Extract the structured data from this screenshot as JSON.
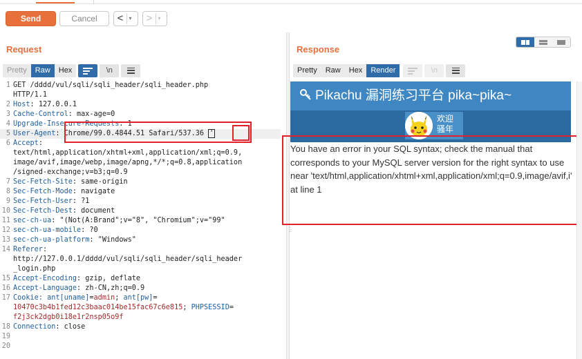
{
  "toolbar": {
    "send_label": "Send",
    "cancel_label": "Cancel",
    "back_glyph": "<",
    "forward_glyph": ">",
    "dropdown_glyph": "▾"
  },
  "request": {
    "title": "Request",
    "modes": [
      "Pretty",
      "Raw",
      "Hex"
    ],
    "selected_mode": "Raw",
    "newline_label": "\\n",
    "lines": [
      {
        "n": "1",
        "text": "GET /dddd/vul/sqli/sqli_header/sqli_header.php"
      },
      {
        "n": "",
        "text": "HTTP/1.1"
      },
      {
        "n": "2",
        "key": "Host",
        "value": "127.0.0.1"
      },
      {
        "n": "3",
        "key": "Cache-Control",
        "value": "max-age=0"
      },
      {
        "n": "4",
        "key": "Upgrade-Insecure-Requests",
        "value": "1"
      },
      {
        "n": "5",
        "key": "User-Agent",
        "value": "Chrome/99.0.4844.51 Safari/537.36",
        "caret": "'"
      },
      {
        "n": "6",
        "key": "Accept",
        "value": ""
      },
      {
        "n": "",
        "text": "text/html,application/xhtml+xml,application/xml;q=0.9,"
      },
      {
        "n": "",
        "text": "image/avif,image/webp,image/apng,*/*;q=0.8,application"
      },
      {
        "n": "",
        "text": "/signed-exchange;v=b3;q=0.9"
      },
      {
        "n": "7",
        "key": "Sec-Fetch-Site",
        "value": "same-origin"
      },
      {
        "n": "8",
        "key": "Sec-Fetch-Mode",
        "value": "navigate"
      },
      {
        "n": "9",
        "key": "Sec-Fetch-User",
        "value": "?1"
      },
      {
        "n": "10",
        "key": "Sec-Fetch-Dest",
        "value": "document"
      },
      {
        "n": "11",
        "key": "sec-ch-ua",
        "value": "\"(Not(A:Brand\";v=\"8\", \"Chromium\";v=\"99\""
      },
      {
        "n": "12",
        "key": "sec-ch-ua-mobile",
        "value": "?0"
      },
      {
        "n": "13",
        "key": "sec-ch-ua-platform",
        "value": "\"Windows\""
      },
      {
        "n": "14",
        "key": "Referer",
        "value": ""
      },
      {
        "n": "",
        "text": "http://127.0.0.1/dddd/vul/sqli/sqli_header/sqli_header"
      },
      {
        "n": "",
        "text": "_login.php"
      },
      {
        "n": "15",
        "key": "Accept-Encoding",
        "value": "gzip, deflate"
      },
      {
        "n": "16",
        "key": "Accept-Language",
        "value": "zh-CN,zh;q=0.9"
      },
      {
        "n": "17",
        "cookie": [
          {
            "t": "Cookie: ant[uname]",
            "c": "k"
          },
          {
            "t": "=",
            "c": ""
          },
          {
            "t": "admin",
            "c": "v"
          },
          {
            "t": "; ",
            "c": ""
          },
          {
            "t": "ant[pw]",
            "c": "k"
          },
          {
            "t": "=",
            "c": ""
          }
        ]
      },
      {
        "n": "",
        "cookie": [
          {
            "t": "10470c3b4b1fed12c3baac014be15fac67c6e815",
            "c": "v"
          },
          {
            "t": "; ",
            "c": ""
          },
          {
            "t": "PHPSESSID",
            "c": "k"
          },
          {
            "t": "=",
            "c": ""
          }
        ]
      },
      {
        "n": "",
        "cookie": [
          {
            "t": "f2j3ck2dgb0i18e1r2nsp05o9f",
            "c": "v"
          }
        ]
      },
      {
        "n": "18",
        "key": "Connection",
        "value": "close"
      },
      {
        "n": "19",
        "text": ""
      },
      {
        "n": "20",
        "text": ""
      }
    ]
  },
  "response": {
    "title": "Response",
    "modes": [
      "Pretty",
      "Raw",
      "Hex",
      "Render"
    ],
    "selected_mode": "Render",
    "newline_label": "\\n",
    "page_header": "Pikachu 漏洞练习平台 pika~pika~",
    "welcome_line1": "欢迎",
    "welcome_line2": "骚年",
    "error_text": "You have an error in your SQL syntax; check the manual that corresponds to your MySQL server version for the right syntax to use near 'text/html,application/xhtml+xml,application/xml;q=0.9,image/avif,i' at line 1"
  },
  "colors": {
    "accent": "#e8703a",
    "selected_tab": "#2f6ca8",
    "header_key": "#2060a0",
    "header_value": "#a52a2a",
    "highlight_box": "#e0202a",
    "pikachu_header": "#3f87c2"
  }
}
